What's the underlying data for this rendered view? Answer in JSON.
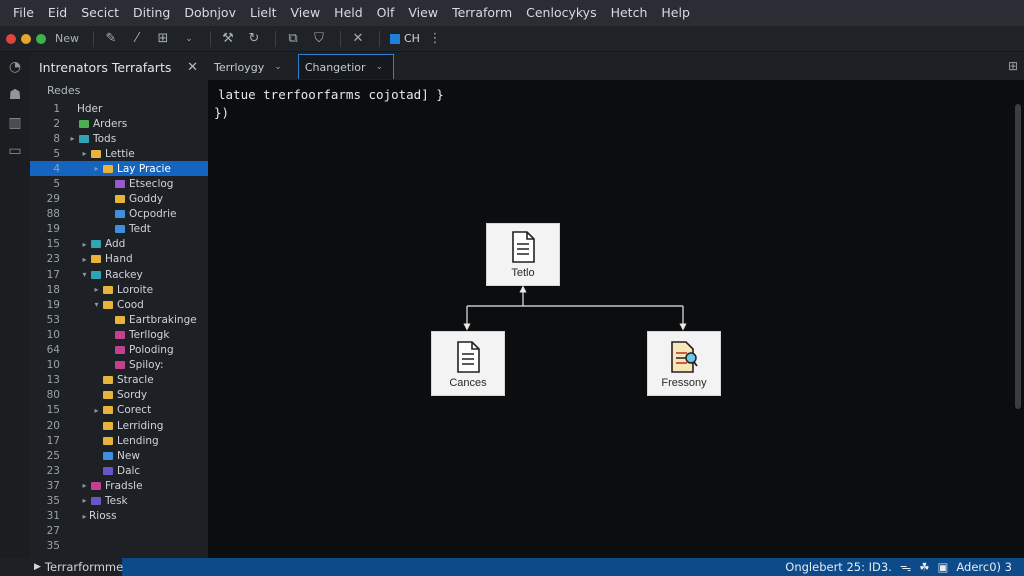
{
  "menu": [
    "File",
    "Eid",
    "Secict",
    "Diting",
    "Dobnjov",
    "Lielt",
    "View",
    "Held",
    "Olf",
    "View",
    "Terraform",
    "Cenlocykys",
    "Hetch",
    "Help"
  ],
  "toolbar": {
    "new_label": "New",
    "ch_label": "CH"
  },
  "sidebar": {
    "title": "Intrenators Terrafarts",
    "section": "Redes",
    "rows": [
      {
        "ln": "1",
        "depth": 0,
        "chev": "",
        "icon": "",
        "label": "Hder"
      },
      {
        "ln": "2",
        "depth": 0,
        "chev": "",
        "icon": "green",
        "label": "Arders"
      },
      {
        "ln": "8",
        "depth": 0,
        "chev": "▸",
        "icon": "teal",
        "label": "Tods"
      },
      {
        "ln": "5",
        "depth": 1,
        "chev": "▸",
        "icon": "yellow",
        "label": "Lettie"
      },
      {
        "ln": "4",
        "depth": 2,
        "chev": "▸",
        "icon": "yellow",
        "label": "Lay Pracie",
        "selected": true
      },
      {
        "ln": "5",
        "depth": 3,
        "chev": "",
        "icon": "purple",
        "label": "Etseclog"
      },
      {
        "ln": "29",
        "depth": 3,
        "chev": "",
        "icon": "yellow",
        "label": "Goddy"
      },
      {
        "ln": "88",
        "depth": 3,
        "chev": "",
        "icon": "blue",
        "label": "Ocpodrie"
      },
      {
        "ln": "19",
        "depth": 3,
        "chev": "",
        "icon": "blue",
        "label": "Tedt"
      },
      {
        "ln": "15",
        "depth": 1,
        "chev": "▸",
        "icon": "teal",
        "label": "Add"
      },
      {
        "ln": "23",
        "depth": 1,
        "chev": "▸",
        "icon": "yellow",
        "label": "Hand"
      },
      {
        "ln": "17",
        "depth": 1,
        "chev": "▾",
        "icon": "teal",
        "label": "Rackey"
      },
      {
        "ln": "18",
        "depth": 2,
        "chev": "▸",
        "icon": "yellow",
        "label": "Loroite"
      },
      {
        "ln": "19",
        "depth": 2,
        "chev": "▾",
        "icon": "yellow",
        "label": "Cood"
      },
      {
        "ln": "53",
        "depth": 3,
        "chev": "",
        "icon": "yellow",
        "label": "Eartbrakinge"
      },
      {
        "ln": "10",
        "depth": 3,
        "chev": "",
        "icon": "pink",
        "label": "Terllogk"
      },
      {
        "ln": "64",
        "depth": 3,
        "chev": "",
        "icon": "pink",
        "label": "Poloding"
      },
      {
        "ln": "10",
        "depth": 3,
        "chev": "",
        "icon": "pink",
        "label": "Spiloy:"
      },
      {
        "ln": "13",
        "depth": 2,
        "chev": "",
        "icon": "yellow",
        "label": "Stracle"
      },
      {
        "ln": "80",
        "depth": 2,
        "chev": "",
        "icon": "yellow",
        "label": "Sordy"
      },
      {
        "ln": "15",
        "depth": 2,
        "chev": "▸",
        "icon": "yellow",
        "label": "Corect"
      },
      {
        "ln": "20",
        "depth": 2,
        "chev": "",
        "icon": "yellow",
        "label": "Lerriding"
      },
      {
        "ln": "17",
        "depth": 2,
        "chev": "",
        "icon": "yellow",
        "label": "Lending"
      },
      {
        "ln": "25",
        "depth": 2,
        "chev": "",
        "icon": "blue",
        "label": "New"
      },
      {
        "ln": "23",
        "depth": 2,
        "chev": "",
        "icon": "indigo",
        "label": "Dalc"
      },
      {
        "ln": "37",
        "depth": 1,
        "chev": "▸",
        "icon": "pink",
        "label": "Fradsle"
      },
      {
        "ln": "35",
        "depth": 1,
        "chev": "▸",
        "icon": "indigo",
        "label": "Tesk"
      },
      {
        "ln": "31",
        "depth": 1,
        "chev": "▸",
        "icon": "",
        "label": "Rioss"
      },
      {
        "ln": "27",
        "depth": 0,
        "chev": "",
        "icon": "",
        "label": ""
      },
      {
        "ln": "35",
        "depth": 0,
        "chev": "",
        "icon": "",
        "label": ""
      }
    ]
  },
  "editor": {
    "tabs": [
      {
        "label": "Terrloygy",
        "active": false
      },
      {
        "label": "Changetior",
        "active": true
      }
    ],
    "code_lines": [
      "latue trerfoorfarms cojotad] }",
      "})"
    ]
  },
  "diagram": {
    "nodes": [
      {
        "id": "top",
        "label": "Tetlo"
      },
      {
        "id": "left",
        "label": "Cances"
      },
      {
        "id": "right",
        "label": "Fressony"
      }
    ]
  },
  "status": {
    "left_label": "Terrarformme",
    "right_text": "Onglebert 25: ID3.",
    "right_tail": "Aderc0) 3"
  },
  "colors": {
    "accent": "#1565c0",
    "statusbar": "#0d4a8a",
    "icon_yellow": "#e8b33a",
    "icon_green": "#4caf50",
    "icon_teal": "#2fa4b5",
    "icon_purple": "#9b59d0",
    "icon_pink": "#c2408f",
    "icon_blue": "#3f8fe0",
    "icon_indigo": "#6a55c8"
  }
}
